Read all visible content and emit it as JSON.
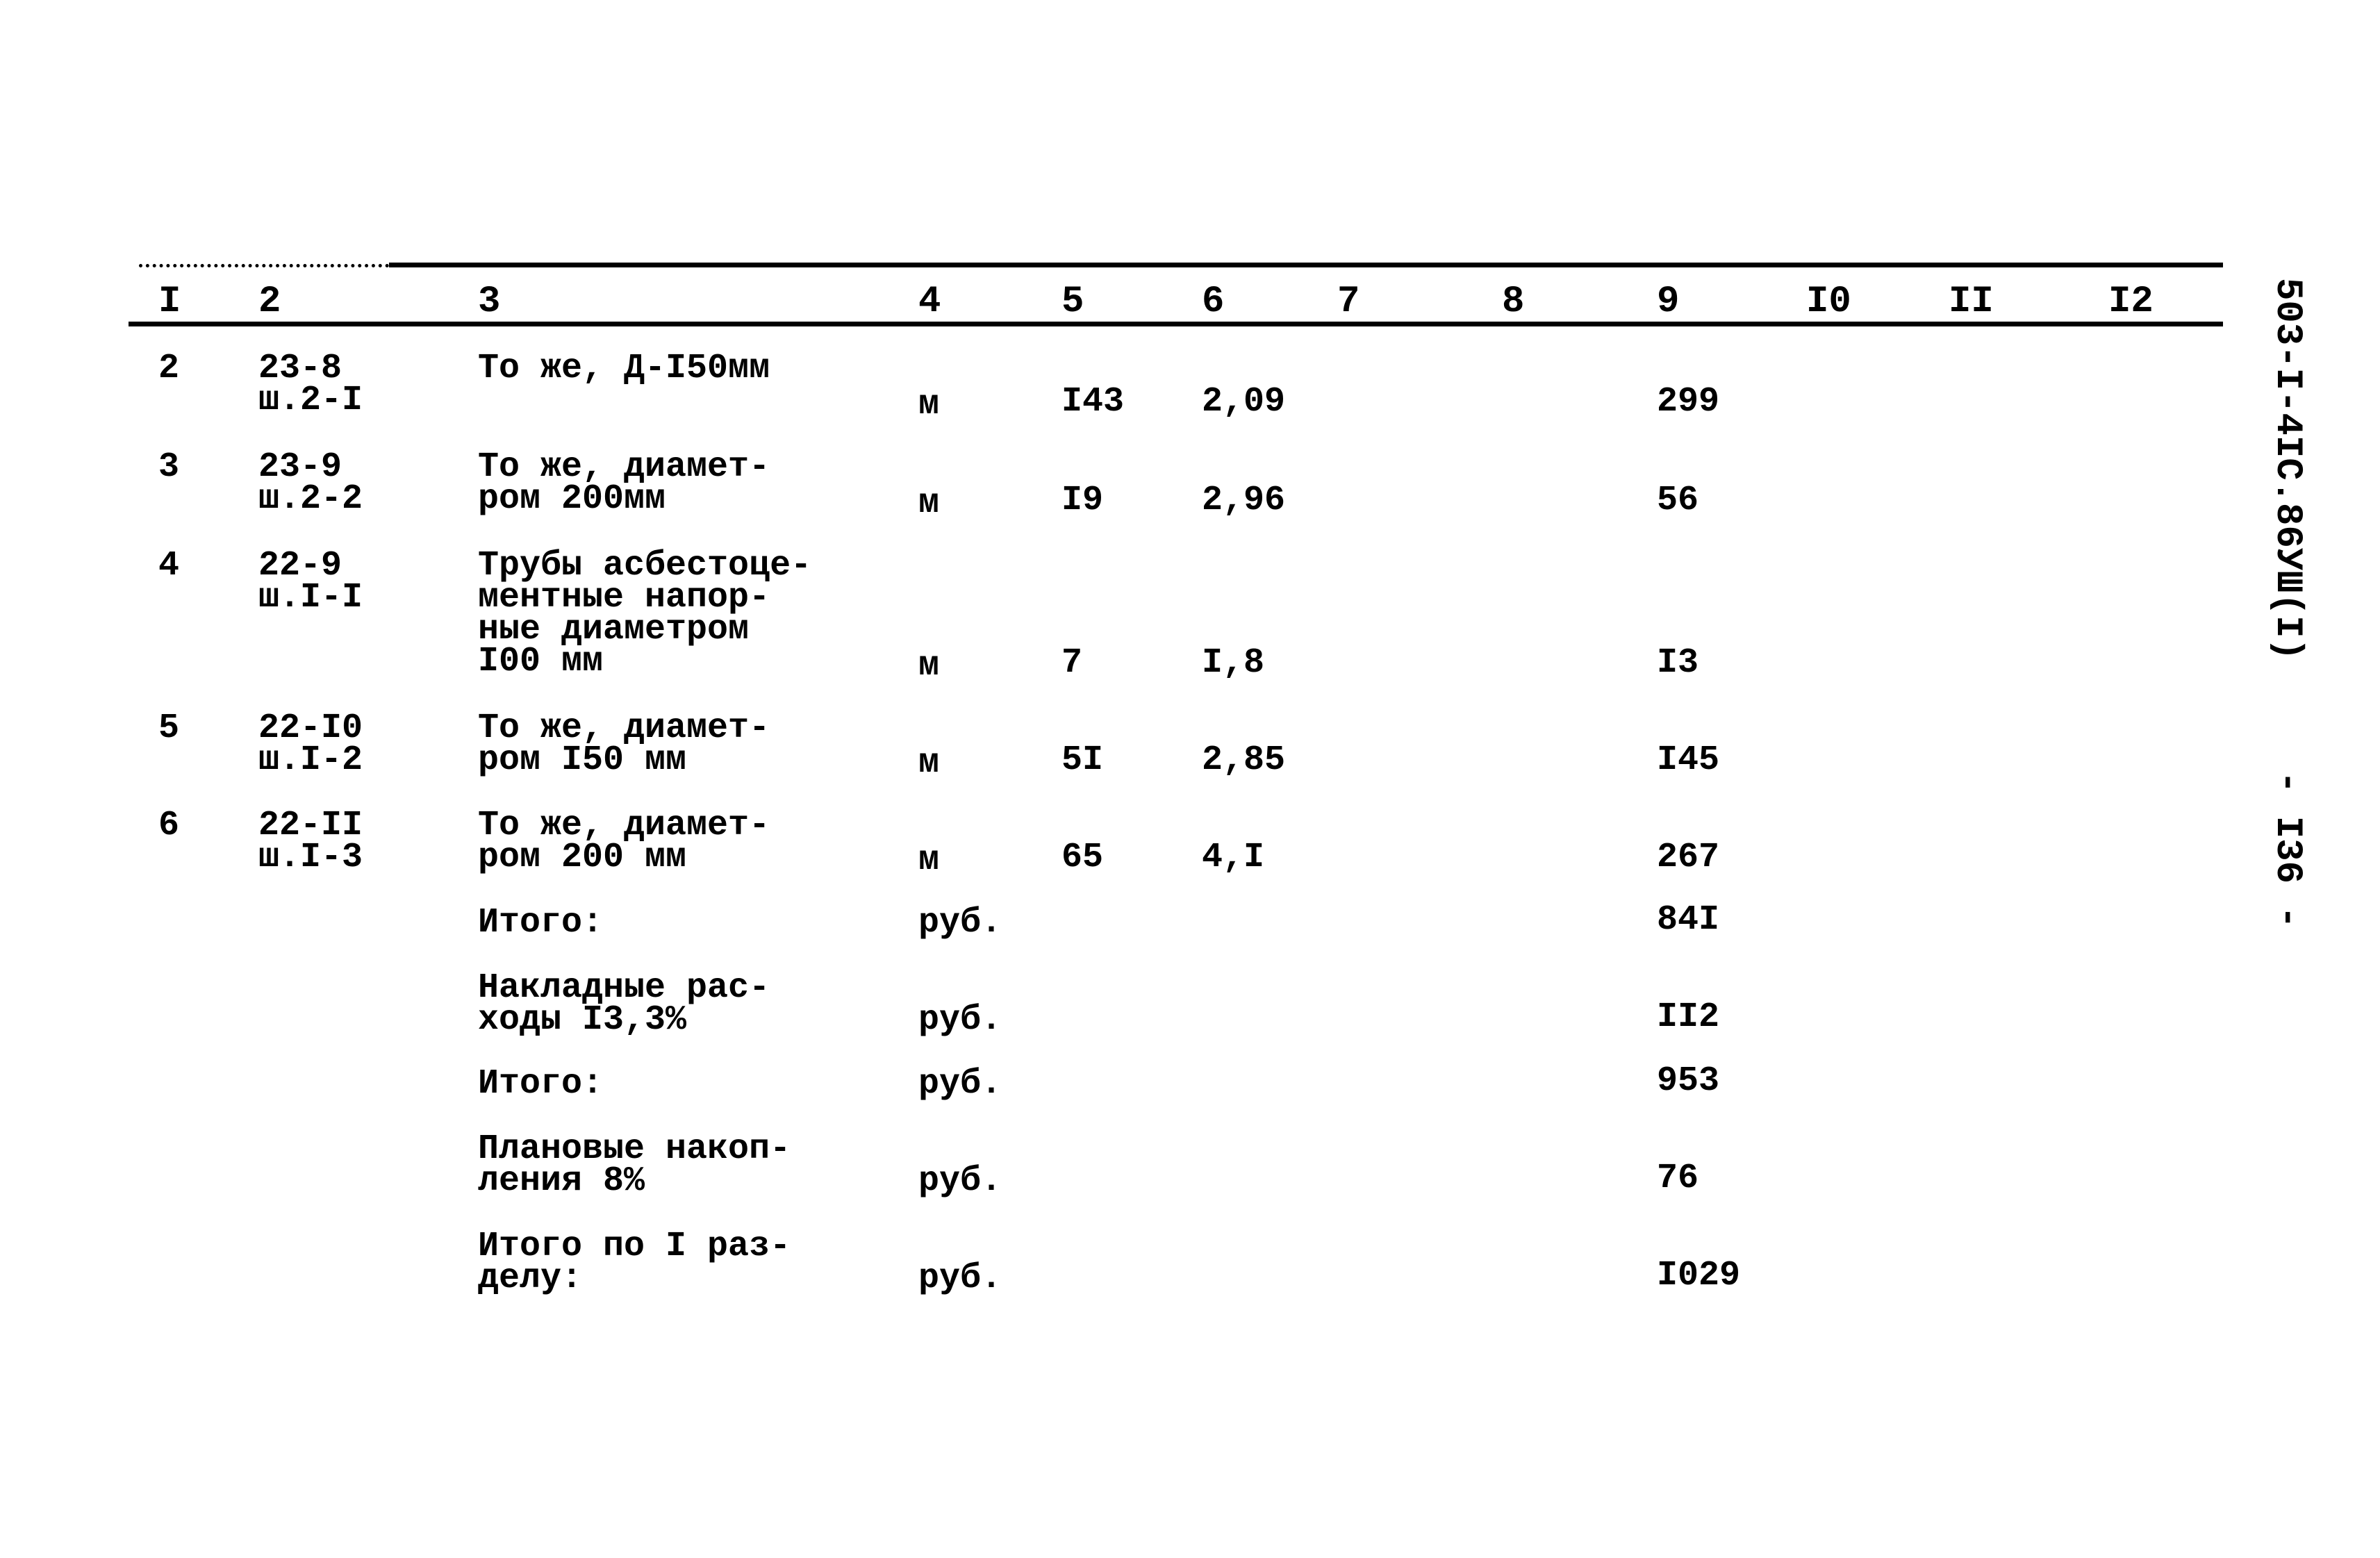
{
  "document": {
    "side_code": "503-I-4IC.86УШ(I)",
    "page_number": "- I36 -"
  },
  "table": {
    "headers": [
      "I",
      "2",
      "3",
      "4",
      "5",
      "6",
      "7",
      "8",
      "9",
      "I0",
      "II",
      "I2"
    ],
    "rows": [
      {
        "no": "2",
        "code": "23-8\nш.2-I",
        "description": "То же, Д-I50мм",
        "unit": "м",
        "qty": "I43",
        "price": "2,09",
        "total": "299"
      },
      {
        "no": "3",
        "code": "23-9\nш.2-2",
        "description": "То же, диамет-\nром 200мм",
        "unit": "м",
        "qty": "I9",
        "price": "2,96",
        "total": "56"
      },
      {
        "no": "4",
        "code": "22-9\nш.I-I",
        "description": "Трубы асбестоце-\nментные напор-\nные диаметром\nI00 мм",
        "unit": "м",
        "qty": "7",
        "price": "I,8",
        "total": "I3"
      },
      {
        "no": "5",
        "code": "22-I0\nш.I-2",
        "description": "То же, диамет-\nром I50 мм",
        "unit": "м",
        "qty": "5I",
        "price": "2,85",
        "total": "I45"
      },
      {
        "no": "6",
        "code": "22-II\nш.I-3",
        "description": "То же, диамет-\nром 200 мм",
        "unit": "м",
        "qty": "65",
        "price": "4,I",
        "total": "267"
      }
    ],
    "summary": [
      {
        "label": "Итого:",
        "unit": "руб.",
        "total": "84I"
      },
      {
        "label": "Накладные рас-\nходы I3,3%",
        "unit": "руб.",
        "total": "II2"
      },
      {
        "label": "Итого:",
        "unit": "руб.",
        "total": "953"
      },
      {
        "label": "Плановые накоп-\nления 8%",
        "unit": "руб.",
        "total": "76"
      },
      {
        "label": "Итого по I раз-\nделу:",
        "unit": "руб.",
        "total": "I029"
      }
    ]
  }
}
